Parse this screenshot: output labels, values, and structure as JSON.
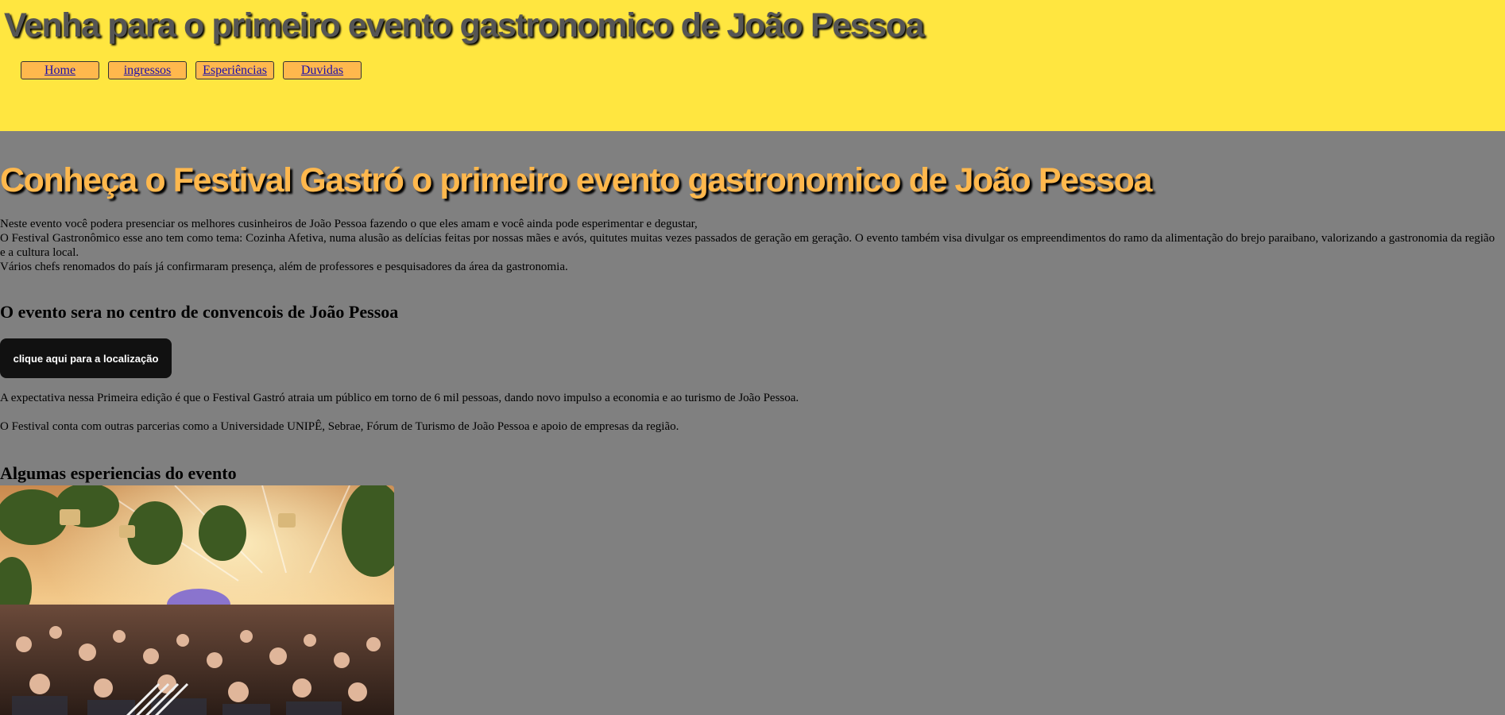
{
  "header": {
    "title": "Venha para o primeiro evento gastronomico de João Pessoa",
    "nav": [
      {
        "label": "Home"
      },
      {
        "label": "ingressos"
      },
      {
        "label": "Esperiências"
      },
      {
        "label": "Duvidas"
      }
    ]
  },
  "main": {
    "title": "Conheça o Festival Gastró o primeiro evento gastronomico de João Pessoa",
    "intro_lines": [
      "Neste evento você podera presenciar os melhores cusinheiros de João Pessoa fazendo o que eles amam e você ainda pode esperimentar e degustar,",
      "O Festival Gastronômico esse ano tem como tema: Cozinha Afetiva, numa alusão as delícias feitas por nossas mães e avós, quitutes muitas vezes passados de geração em geração. O evento também visa divulgar os empreendimentos do ramo da alimentação do brejo paraibano, valorizando a gastronomia da região e a cultura local.",
      "Vários chefs renomados do país já confirmaram presença, além de professores e pesquisadores da área da gastronomia."
    ],
    "location_heading": "O evento sera no centro de convencois de João Pessoa",
    "location_button": "clique aqui para a localização",
    "paragraph1": "A expectativa nessa Primeira edição é que o Festival Gastró atraia um público em torno de 6 mil pessoas, dando novo impulso a economia e ao turismo de João Pessoa.",
    "paragraph2": "O Festival conta com outras parcerias como a Universidade UNIPÊ, Sebrae, Fórum de Turismo de João Pessoa e apoio de empresas da região.",
    "experiences_heading": "Algumas esperiencias do evento"
  },
  "colors": {
    "header_bg": "#ffe640",
    "page_bg": "#808080",
    "nav_button_bg": "#ffb84d",
    "main_title": "#ffb84d",
    "button_bg": "#111111"
  }
}
